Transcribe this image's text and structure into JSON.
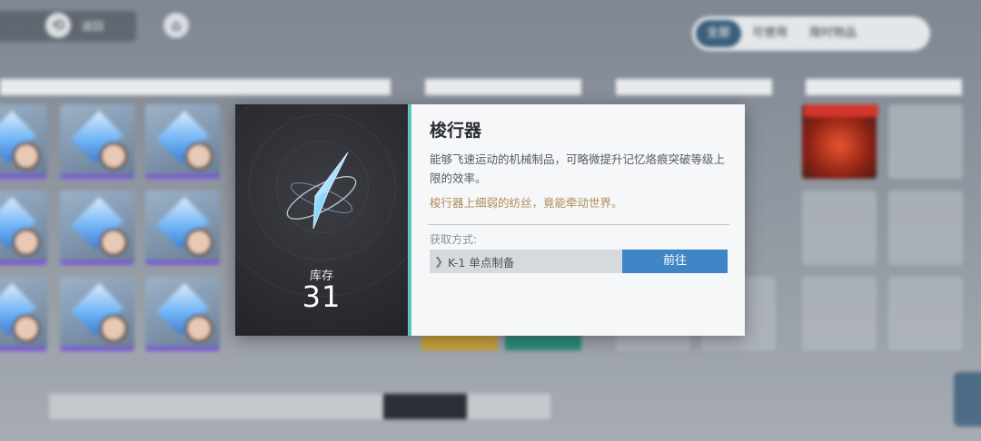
{
  "top_bar": {
    "back_label": "返回",
    "back_icon": "back-icon",
    "home_icon": "home-icon"
  },
  "filter_tabs": [
    {
      "label": "全部",
      "active": true
    },
    {
      "label": "可使用",
      "active": false
    },
    {
      "label": "限时物品",
      "active": false
    }
  ],
  "popup": {
    "item_name": "梭行器",
    "description": "能够飞速运动的机械制品，可略微提升记忆烙痕突破等级上限的效率。",
    "flavor_text": "梭行器上细弱的纺丝，竟能牵动世界。",
    "stock_label": "库存",
    "stock_count": "31",
    "obtain_label": "获取方式:",
    "source_name": "K-1 单点制备",
    "go_button": "前往",
    "colors": {
      "accent_bar": "#5ec6b8",
      "go_button": "#3e86c6",
      "flavor_text": "#b08c5a"
    }
  }
}
